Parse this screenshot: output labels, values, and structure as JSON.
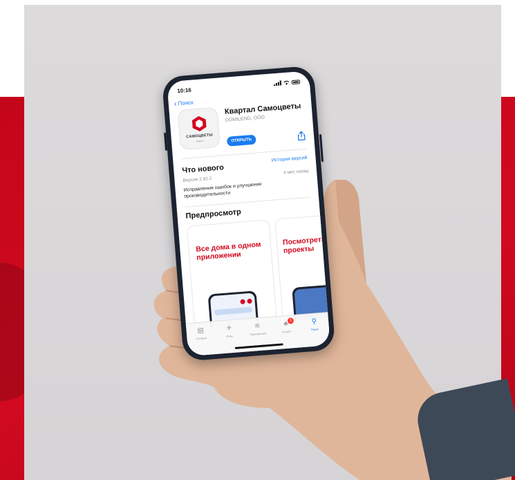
{
  "status_bar": {
    "time": "10:16"
  },
  "nav": {
    "back_label": "Поиск"
  },
  "app": {
    "title": "Квартал Самоцветы",
    "developer": "DOMILEND, OOO",
    "icon_brand": "САМОЦВЕТЫ",
    "icon_sub": "квартал",
    "open_label": "ОТКРЫТЬ"
  },
  "whats_new": {
    "title": "Что нового",
    "history_link": "История версий",
    "version": "Версия 2.82.2",
    "age": "4 мес назад",
    "notes": "Исправления ошибок и улучшение производительности"
  },
  "preview": {
    "title": "Предпросмотр",
    "cards": [
      "Все дома в одном приложении",
      "Посмотреть проекты"
    ]
  },
  "tabbar": {
    "tabs": [
      {
        "label": "Сегодня",
        "icon": "today-icon"
      },
      {
        "label": "Игры",
        "icon": "games-icon"
      },
      {
        "label": "Приложения",
        "icon": "apps-icon"
      },
      {
        "label": "Arcade",
        "icon": "arcade-icon",
        "badge": "1"
      },
      {
        "label": "Поиск",
        "icon": "search-icon",
        "active": true
      }
    ]
  },
  "colors": {
    "accent": "#d10a20",
    "ios_blue": "#1a7cf0",
    "background": "#d8d6d8"
  }
}
